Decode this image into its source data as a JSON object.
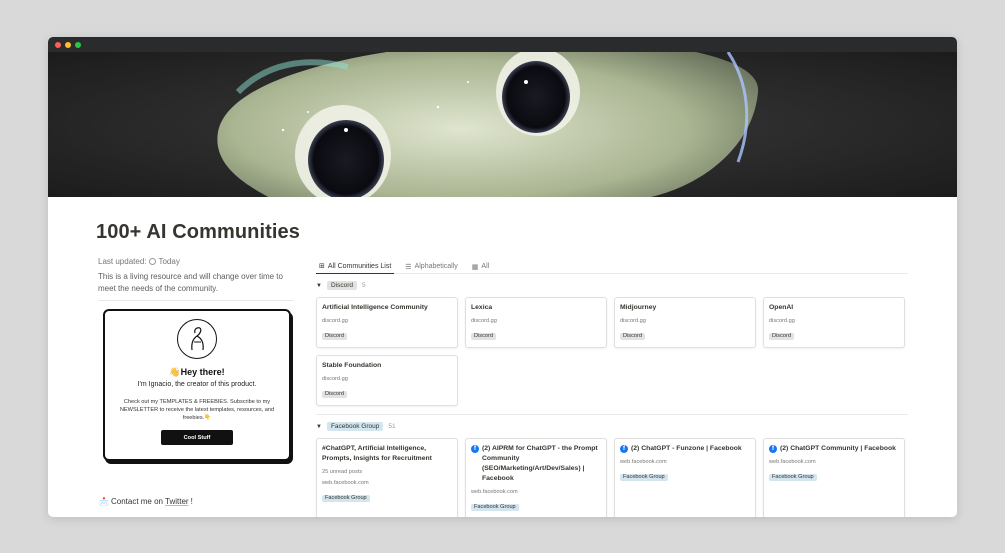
{
  "window": {
    "controls": [
      "close",
      "minimize",
      "maximize"
    ]
  },
  "page": {
    "title": "100+ AI Communities",
    "last_updated_label": "Last updated:",
    "last_updated_value": "Today",
    "description": "This is a living resource and will change over time to meet the needs of the community."
  },
  "promo": {
    "title": "Hey there!",
    "subtitle": "I'm Ignacio, the creator of this product.",
    "body": "Check out my TEMPLATES & FREEBIES. Subscribe to my NEWSLETTER to receive the latest templates, resources, and freebies.",
    "button": "Cool Stuff"
  },
  "contact": {
    "prefix": "Contact me on",
    "link": "Twitter",
    "suffix": "!"
  },
  "tabs": [
    {
      "label": "All Communities List",
      "icon": "gallery-icon",
      "active": true
    },
    {
      "label": "Alphabetically",
      "icon": "list-icon",
      "active": false
    },
    {
      "label": "All",
      "icon": "table-icon",
      "active": false
    }
  ],
  "groups": [
    {
      "name": "Discord",
      "count": "5",
      "color": "gray",
      "cards": [
        {
          "title": "Artificial Intelligence Community",
          "domain": "discord.gg",
          "tag": "Discord"
        },
        {
          "title": "Lexica",
          "domain": "discord.gg",
          "tag": "Discord"
        },
        {
          "title": "Midjourney",
          "domain": "discord.gg",
          "tag": "Discord"
        },
        {
          "title": "OpenAI",
          "domain": "discord.gg",
          "tag": "Discord"
        },
        {
          "title": "Stable Foundation",
          "domain": "discord.gg",
          "tag": "Discord"
        }
      ]
    },
    {
      "name": "Facebook Group",
      "count": "51",
      "color": "blue",
      "cards": [
        {
          "title": "#ChatGPT, Artificial Intelligence, Prompts, Insights for Recruitment",
          "extra": "25 unread posts",
          "domain": "web.facebook.com",
          "tag": "Facebook Group",
          "fb": false
        },
        {
          "title": "(2) AIPRM for ChatGPT - the Prompt Community (SEO/Marketing/Art/Dev/Sales) | Facebook",
          "domain": "web.facebook.com",
          "tag": "Facebook Group",
          "fb": true
        },
        {
          "title": "(2) ChatGPT - Funzone | Facebook",
          "domain": "web.facebook.com",
          "tag": "Facebook Group",
          "fb": true
        },
        {
          "title": "(2) ChatGPT Community | Facebook",
          "domain": "web.facebook.com",
          "tag": "Facebook Group",
          "fb": true
        }
      ]
    }
  ]
}
